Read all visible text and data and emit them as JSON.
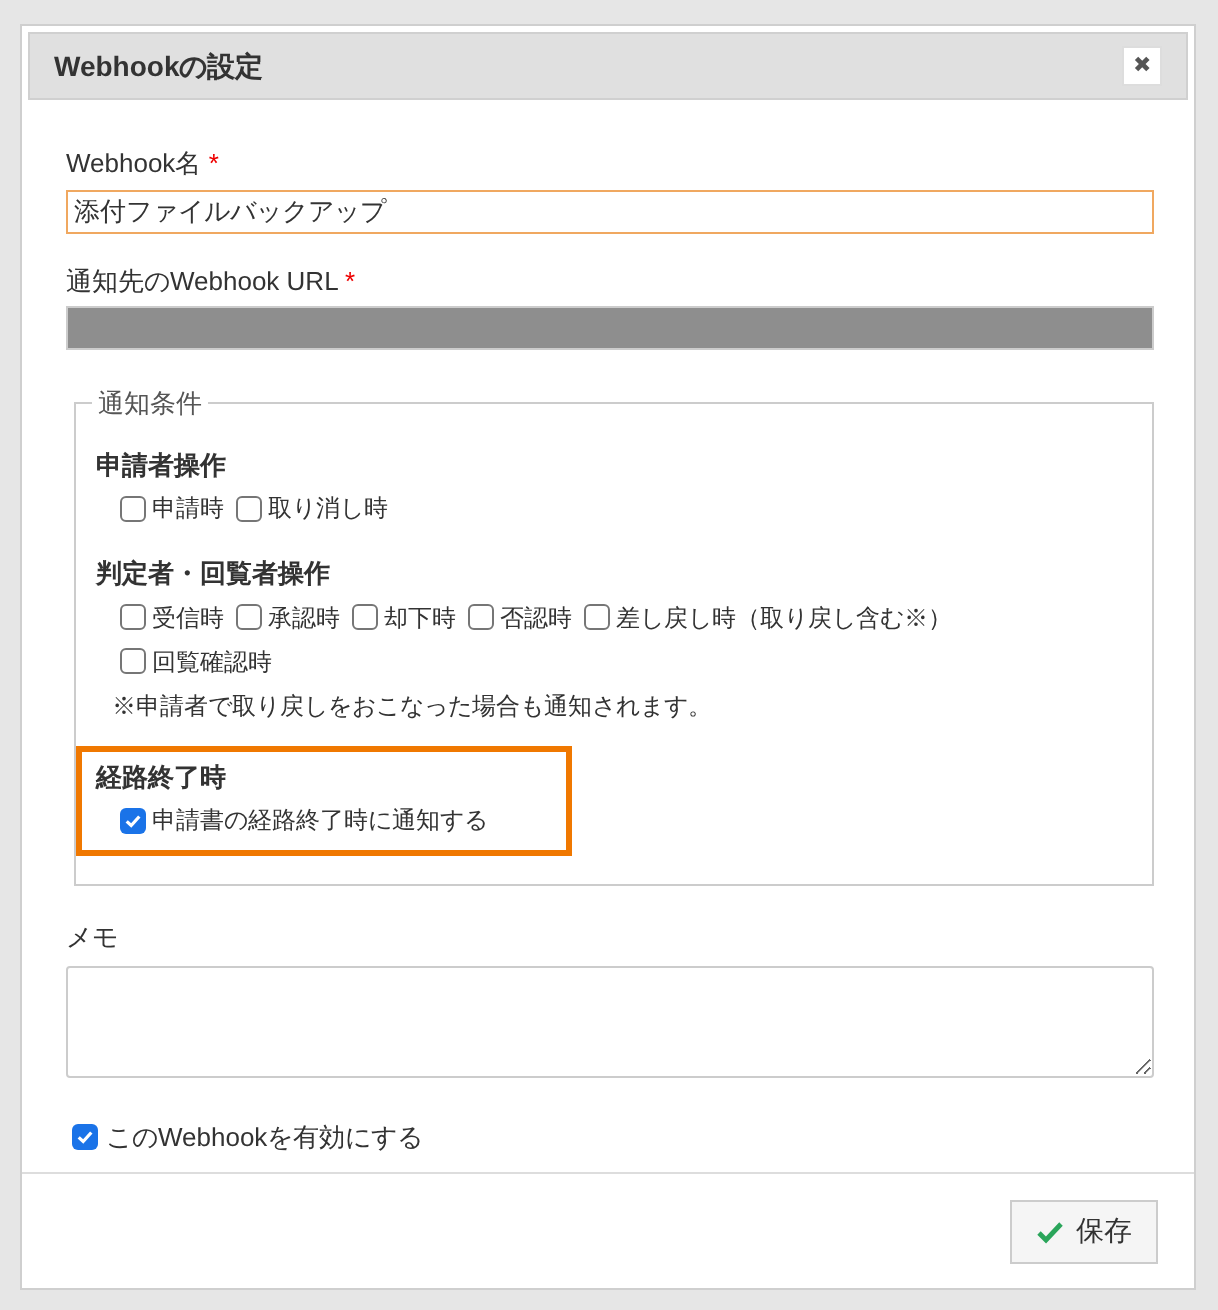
{
  "dialog": {
    "title": "Webhookの設定",
    "close": "✖"
  },
  "name_field": {
    "label": "Webhook名",
    "required": "*",
    "value": "添付ファイルバックアップ",
    "focused": true
  },
  "url_field": {
    "label": "通知先のWebhook URL",
    "required": "*",
    "redacted": true
  },
  "conditions": {
    "legend": "通知条件",
    "groups": [
      {
        "title": "申請者操作",
        "highlighted": false,
        "options": [
          {
            "label": "申請時",
            "checked": false
          },
          {
            "label": "取り消し時",
            "checked": false
          }
        ]
      },
      {
        "title": "判定者・回覧者操作",
        "highlighted": false,
        "options": [
          {
            "label": "受信時",
            "checked": false
          },
          {
            "label": "承認時",
            "checked": false
          },
          {
            "label": "却下時",
            "checked": false
          },
          {
            "label": "否認時",
            "checked": false
          },
          {
            "label": "差し戻し時（取り戻し含む※）",
            "checked": false
          },
          {
            "label": "回覧確認時",
            "checked": false
          }
        ],
        "note": "※申請者で取り戻しをおこなった場合も通知されます。"
      },
      {
        "title": "経路終了時",
        "highlighted": true,
        "options": [
          {
            "label": "申請書の経路終了時に通知する",
            "checked": true
          }
        ]
      }
    ]
  },
  "memo": {
    "label": "メモ"
  },
  "enabled": {
    "label": "このWebhookを有効にする",
    "checked": true
  },
  "save_button": {
    "label": "保存"
  }
}
